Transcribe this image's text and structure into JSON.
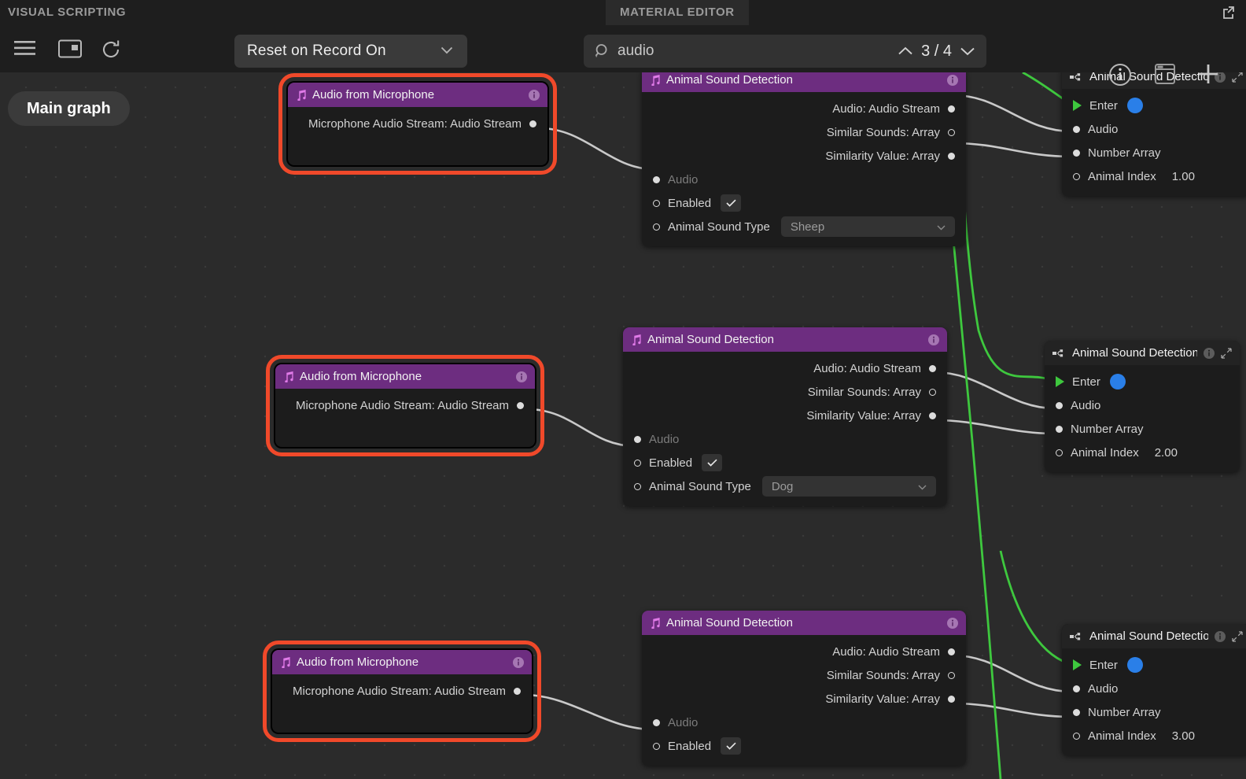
{
  "app": {
    "tabs": [
      {
        "id": "visual-scripting",
        "label": "VISUAL SCRIPTING",
        "active": true
      },
      {
        "id": "material-editor",
        "label": "MATERIAL EDITOR",
        "active": false
      }
    ],
    "popout_icon": "open-in-new-window-icon"
  },
  "toolbar": {
    "menu_icon": "hamburger-menu-icon",
    "panel_icon": "panel-layout-icon",
    "reload_icon": "reload-icon",
    "reset_dropdown": {
      "value": "Reset on Record On",
      "chevron": "chevron-down-icon"
    },
    "search": {
      "icon": "search-icon",
      "value": "audio",
      "placeholder": "Search",
      "prev_icon": "chevron-up-icon",
      "next_icon": "chevron-down-icon",
      "match_count": "3 / 4"
    },
    "info_icon": "info-icon",
    "window_icon": "window-panel-icon",
    "add_icon": "plus-icon"
  },
  "canvas": {
    "breadcrumb": "Main graph"
  },
  "nodes": [
    {
      "id": "mic1",
      "title": "Audio from Microphone",
      "icon": "music-note-icon",
      "info_icon": "info-icon",
      "selected": true,
      "outputs": [
        {
          "label": "Microphone Audio Stream: Audio Stream",
          "port": "filled"
        }
      ],
      "inputs": []
    },
    {
      "id": "asd1",
      "title": "Animal Sound Detection",
      "icon": "music-note-icon",
      "info_icon": "info-icon",
      "selected": false,
      "outputs": [
        {
          "label": "Audio: Audio Stream",
          "port": "filled"
        },
        {
          "label": "Similar Sounds:  Array",
          "port": "hollow"
        },
        {
          "label": "Similarity Value:  Array",
          "port": "filled"
        }
      ],
      "inputs": [
        {
          "label": "Audio",
          "port": "filled",
          "dim": true
        },
        {
          "label": "Enabled",
          "port": "hollow",
          "control": "checkbox",
          "checked": true
        },
        {
          "label": "Animal Sound Type",
          "port": "hollow",
          "control": "dropdown",
          "value": "Sheep"
        }
      ]
    },
    {
      "id": "sub1",
      "title": "Animal Sound Detection",
      "icon": "subgraph-icon",
      "info_icon": "info-icon",
      "expand_icon": "expand-arrows-icon",
      "selected": false,
      "inputs": [
        {
          "label": "Enter",
          "port": "triangle",
          "control": "color-dot",
          "color": "#2a7fe8"
        },
        {
          "label": "Audio",
          "port": "filled"
        },
        {
          "label": "Number Array",
          "port": "filled"
        },
        {
          "label": "Animal Index",
          "port": "hollow",
          "value": "1.00"
        }
      ]
    },
    {
      "id": "mic2",
      "title": "Audio from Microphone",
      "icon": "music-note-icon",
      "info_icon": "info-icon",
      "selected": true,
      "outputs": [
        {
          "label": "Microphone Audio Stream: Audio Stream",
          "port": "filled"
        }
      ],
      "inputs": []
    },
    {
      "id": "asd2",
      "title": "Animal Sound Detection",
      "icon": "music-note-icon",
      "info_icon": "info-icon",
      "selected": false,
      "outputs": [
        {
          "label": "Audio: Audio Stream",
          "port": "filled"
        },
        {
          "label": "Similar Sounds:  Array",
          "port": "hollow"
        },
        {
          "label": "Similarity Value:  Array",
          "port": "filled"
        }
      ],
      "inputs": [
        {
          "label": "Audio",
          "port": "filled",
          "dim": true
        },
        {
          "label": "Enabled",
          "port": "hollow",
          "control": "checkbox",
          "checked": true
        },
        {
          "label": "Animal Sound Type",
          "port": "hollow",
          "control": "dropdown",
          "value": "Dog"
        }
      ]
    },
    {
      "id": "sub2",
      "title": "Animal Sound Detection",
      "icon": "subgraph-icon",
      "info_icon": "info-icon",
      "expand_icon": "expand-arrows-icon",
      "selected": false,
      "inputs": [
        {
          "label": "Enter",
          "port": "triangle",
          "control": "color-dot",
          "color": "#2a7fe8"
        },
        {
          "label": "Audio",
          "port": "filled"
        },
        {
          "label": "Number Array",
          "port": "filled"
        },
        {
          "label": "Animal Index",
          "port": "hollow",
          "value": "2.00"
        }
      ]
    },
    {
      "id": "mic3",
      "title": "Audio from Microphone",
      "icon": "music-note-icon",
      "info_icon": "info-icon",
      "selected": true,
      "outputs": [
        {
          "label": "Microphone Audio Stream: Audio Stream",
          "port": "filled"
        }
      ],
      "inputs": []
    },
    {
      "id": "asd3",
      "title": "Animal Sound Detection",
      "icon": "music-note-icon",
      "info_icon": "info-icon",
      "selected": false,
      "outputs": [
        {
          "label": "Audio: Audio Stream",
          "port": "filled"
        },
        {
          "label": "Similar Sounds:  Array",
          "port": "hollow"
        },
        {
          "label": "Similarity Value:  Array",
          "port": "filled"
        }
      ],
      "inputs": [
        {
          "label": "Audio",
          "port": "filled",
          "dim": true
        },
        {
          "label": "Enabled",
          "port": "hollow",
          "control": "checkbox",
          "checked": true
        }
      ]
    },
    {
      "id": "sub3",
      "title": "Animal Sound Detection",
      "icon": "subgraph-icon",
      "info_icon": "info-icon",
      "expand_icon": "expand-arrows-icon",
      "selected": false,
      "inputs": [
        {
          "label": "Enter",
          "port": "triangle",
          "control": "color-dot",
          "color": "#2a7fe8"
        },
        {
          "label": "Audio",
          "port": "filled"
        },
        {
          "label": "Number Array",
          "port": "filled"
        },
        {
          "label": "Animal Index",
          "port": "hollow",
          "value": "3.00"
        }
      ]
    }
  ],
  "colors": {
    "selection_outline": "#f0492a",
    "node_header_purple": "#6d2d80",
    "data_wire": "#c9c9c9",
    "exec_wire": "#3ec83e",
    "enter_dot_blue": "#2a7fe8",
    "canvas_bg": "#2b2b2b",
    "chrome_bg": "#1e1e1e"
  },
  "node_titles": {
    "mic": "Audio from Microphone",
    "asd": "Animal Sound Detection",
    "mic_output": "Microphone Audio Stream: Audio Stream",
    "out_audio": "Audio: Audio Stream",
    "out_similar": "Similar Sounds:  Array",
    "out_simval": "Similarity Value:  Array",
    "in_audio": "Audio",
    "in_enabled": "Enabled",
    "in_type": "Animal Sound Type",
    "in_enter": "Enter",
    "in_numarray": "Number Array",
    "in_animidx": "Animal Index",
    "type_sheep": "Sheep",
    "type_dog": "Dog",
    "idx1": "1.00",
    "idx2": "2.00",
    "idx3": "3.00"
  }
}
